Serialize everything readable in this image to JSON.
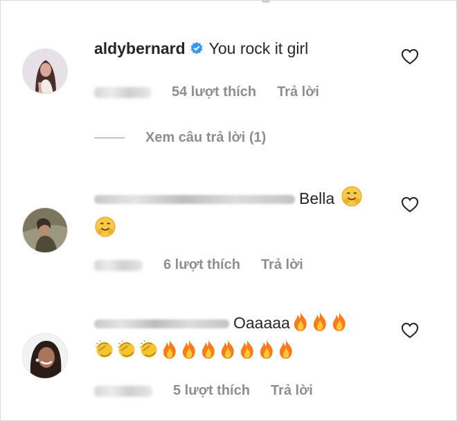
{
  "comments": [
    {
      "username": "aldybernard",
      "verified": true,
      "text": "You rock it girl",
      "likes": "54 lượt thích",
      "reply": "Trả lời",
      "view_replies": "Xem câu trả lời (1)"
    },
    {
      "text": "Bella",
      "likes": "6 lượt thích",
      "reply": "Trả lời"
    },
    {
      "text": "Oaaaaa",
      "likes": "5 lượt thích",
      "reply": "Trả lời"
    }
  ],
  "icons": {
    "like": "heart-outline-icon",
    "verified": "verified-badge-icon",
    "emoji_smile": "smiling-face-emoji",
    "emoji_fire": "fire-emoji",
    "emoji_clap": "clapping-hands-emoji"
  },
  "colors": {
    "text": "#262626",
    "secondary": "#8e8e8e",
    "verified": "#3897f0",
    "fire": "#ff7a00"
  }
}
